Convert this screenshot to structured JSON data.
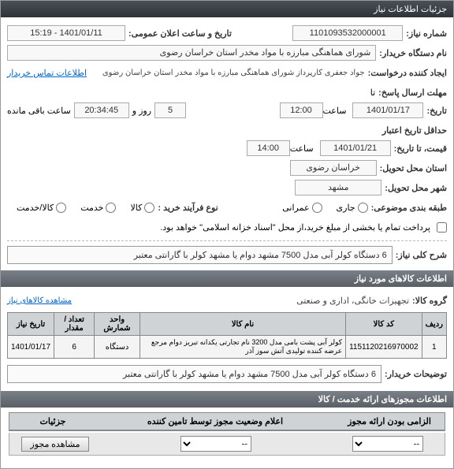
{
  "window": {
    "title": "جزئیات اطلاعات نیاز"
  },
  "form": {
    "need_no_label": "شماره نیاز:",
    "need_no": "1101093532000001",
    "announce_label": "تاریخ و ساعت اعلان عمومی:",
    "announce_value": "1401/01/11 - 15:19",
    "buyer_label": "نام دستگاه خریدار:",
    "buyer_value": "شورای هماهنگی مبارزه با مواد مخدر استان خراسان رضوی",
    "requester_label": "ایجاد کننده درخواست:",
    "requester_value": "جواد جعفری کارپرداز شورای هماهنگی مبارزه با مواد مخدر استان خراسان رضوی",
    "contact_link": "اطلاعات تماس خریدار",
    "send_deadline_label": "مهلت ارسال پاسخ:",
    "to_label": "تا",
    "send_deadline_date": "1401/01/17",
    "hour_label": "ساعت",
    "send_deadline_time": "12:00",
    "day_label": "روز و",
    "days_remaining": "5",
    "remain_text": "ساعت باقی مانده",
    "remain_time": "20:34:45",
    "validity_label": "حداقل تاریخ اعتبار",
    "history_label": "تاریخ:",
    "price_to_label": "قیمت، تا تاریخ:",
    "validity_date": "1401/01/21",
    "validity_time": "14:00",
    "province_label": "استان محل تحویل:",
    "province": "خراسان رضوی",
    "city_label": "شهر محل تحویل:",
    "city": "مشهد",
    "budget_label": "طبقه بندی موضوعی:",
    "budget_opts": {
      "jari": "جاری",
      "omrani": "عمرانی"
    },
    "purchase_type_label": "نوع فرآیند خرید :",
    "purchase_opts": {
      "goods": "کالا",
      "service": "خدمت",
      "both": "کالا/خدمت"
    },
    "payment_check_text": "پرداخت تمام یا بخشی از مبلغ خرید،از محل \"اسناد خزانه اسلامی\" خواهد بود.",
    "desc_label": "شرح کلی نیاز:",
    "desc_value": "6 دستگاه کولر آبی مدل 7500 مشهد دوام یا مشهد کولر با گارانتی معتبر",
    "section_items": "اطلاعات کالاهای مورد نیاز",
    "group_label": "گروه کالا:",
    "group_value": "تجهیزات خانگی، اداری و صنعتی",
    "more_link": "مشاهده کالاهای نیاز",
    "table": {
      "headers": [
        "ردیف",
        "کد کالا",
        "نام کالا",
        "واحد شمارش",
        "تعداد / مقدار",
        "تاریخ نیاز"
      ],
      "rows": [
        {
          "idx": "1",
          "code": "1151120216970002",
          "name": "کولر آبی پشت بامی مدل 3200 نام تجارتی یکدانه تبریز دوام مرجع عرضه کننده تولیدی آتش سوز آذر",
          "unit": "دستگاه",
          "qty": "6",
          "date": "1401/01/17"
        }
      ]
    },
    "buyer_note_label": "توضیحات خریدار:",
    "buyer_note": "6 دستگاه کولر آبی مدل 7500 مشهد دوام یا مشهد کولر با گارانتی معتبر",
    "section_permits": "اطلاعات مجوزهای ارائه خدمت / کالا",
    "status_col1": "الزامی بودن ارائه مجوز",
    "status_col2": "اعلام وضعیت مجوز توسط تامین کننده",
    "status_col3": "جزئیات",
    "select_placeholder": "--",
    "btn_view": "مشاهده مجوز"
  }
}
